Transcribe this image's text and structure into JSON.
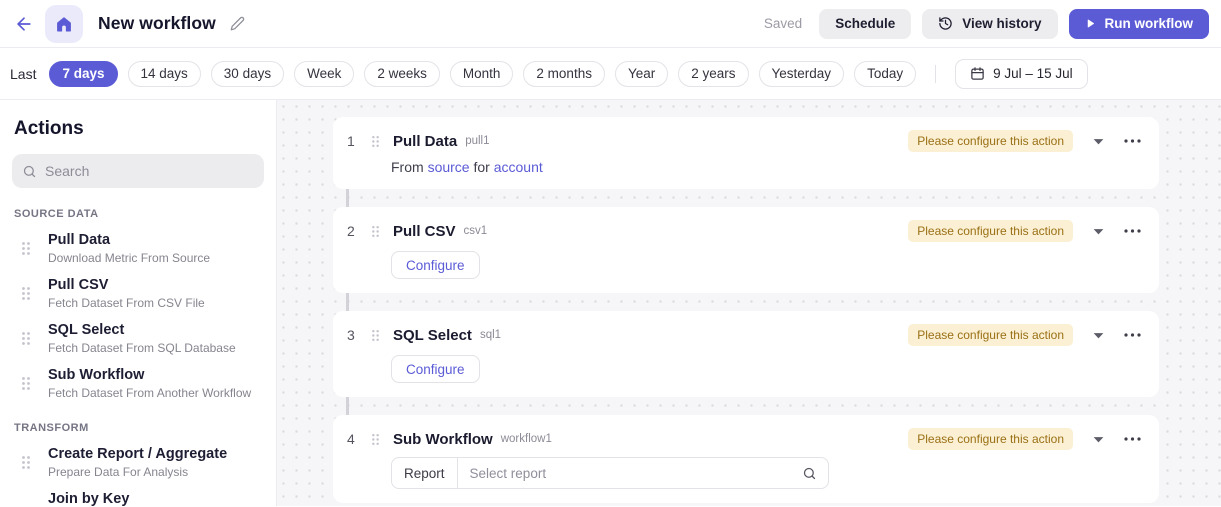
{
  "colors": {
    "accent": "#5b5bd6",
    "accent_soft": "#eaeafb",
    "badge_bg": "#fbf0d3",
    "badge_text": "#9a7016"
  },
  "header": {
    "title": "New workflow",
    "saved_label": "Saved",
    "schedule_label": "Schedule",
    "view_history_label": "View history",
    "run_label": "Run workflow"
  },
  "filters": {
    "last_label": "Last",
    "options": [
      "7 days",
      "14 days",
      "30 days",
      "Week",
      "2 weeks",
      "Month",
      "2 months",
      "Year",
      "2 years",
      "Yesterday",
      "Today"
    ],
    "selected": "7 days",
    "date_range": "9 Jul – 15 Jul"
  },
  "sidebar": {
    "title": "Actions",
    "search_placeholder": "Search",
    "sections": [
      {
        "label": "SOURCE DATA",
        "items": [
          {
            "title": "Pull Data",
            "subtitle": "Download Metric From Source"
          },
          {
            "title": "Pull CSV",
            "subtitle": "Fetch Dataset From CSV File"
          },
          {
            "title": "SQL Select",
            "subtitle": "Fetch Dataset From SQL Database"
          },
          {
            "title": "Sub Workflow",
            "subtitle": "Fetch Dataset From Another Workflow"
          }
        ]
      },
      {
        "label": "TRANSFORM",
        "items": [
          {
            "title": "Create Report / Aggregate",
            "subtitle": "Prepare Data For Analysis"
          },
          {
            "title": "Join by Key",
            "subtitle": ""
          }
        ]
      }
    ]
  },
  "workflow": {
    "badge_label": "Please configure this action",
    "steps": [
      {
        "number": "1",
        "title": "Pull Data",
        "id": "pull1",
        "body": {
          "text1": "From",
          "link1": "source",
          "text2": "for",
          "link2": "account"
        }
      },
      {
        "number": "2",
        "title": "Pull CSV",
        "id": "csv1",
        "configure_label": "Configure"
      },
      {
        "number": "3",
        "title": "SQL Select",
        "id": "sql1",
        "configure_label": "Configure"
      },
      {
        "number": "4",
        "title": "Sub Workflow",
        "id": "workflow1",
        "report_label": "Report",
        "report_placeholder": "Select report"
      }
    ]
  }
}
